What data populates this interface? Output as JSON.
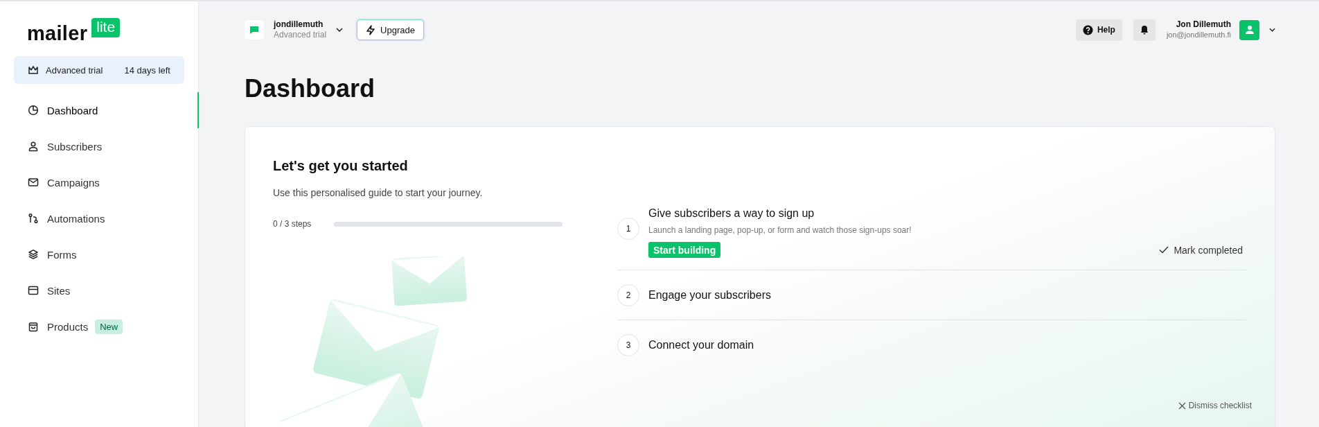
{
  "sidebar": {
    "logo": {
      "word": "mailer",
      "tag": "lite"
    },
    "trial": {
      "label": "Advanced trial",
      "days": "14 days left"
    },
    "items": [
      {
        "label": "Dashboard",
        "selected": true
      },
      {
        "label": "Subscribers",
        "selected": false
      },
      {
        "label": "Campaigns",
        "selected": false
      },
      {
        "label": "Automations",
        "selected": false
      },
      {
        "label": "Forms",
        "selected": false
      },
      {
        "label": "Sites",
        "selected": false
      },
      {
        "label": "Products",
        "selected": false,
        "badge": "New"
      }
    ]
  },
  "topbar": {
    "account": {
      "name": "jondillemuth",
      "plan": "Advanced trial"
    },
    "upgrade": "Upgrade",
    "help": "Help",
    "user": {
      "name": "Jon Dillemuth",
      "email": "jon@jondillemuth.fi"
    }
  },
  "page_title": "Dashboard",
  "checklist": {
    "title": "Let's get you started",
    "subtitle": "Use this personalised guide to start your journey.",
    "progress": {
      "text": "0 / 3 steps",
      "level": 0
    },
    "steps": [
      {
        "number": "1",
        "title": "Give subscribers a way to sign up",
        "description": "Launch a landing page, pop-up, or form and watch those sign-ups soar!",
        "action": "Start building",
        "mark": "Mark completed"
      },
      {
        "number": "2",
        "title": "Engage your subscribers"
      },
      {
        "number": "3",
        "title": "Connect your domain"
      }
    ],
    "dismiss": "Dismiss checklist"
  }
}
